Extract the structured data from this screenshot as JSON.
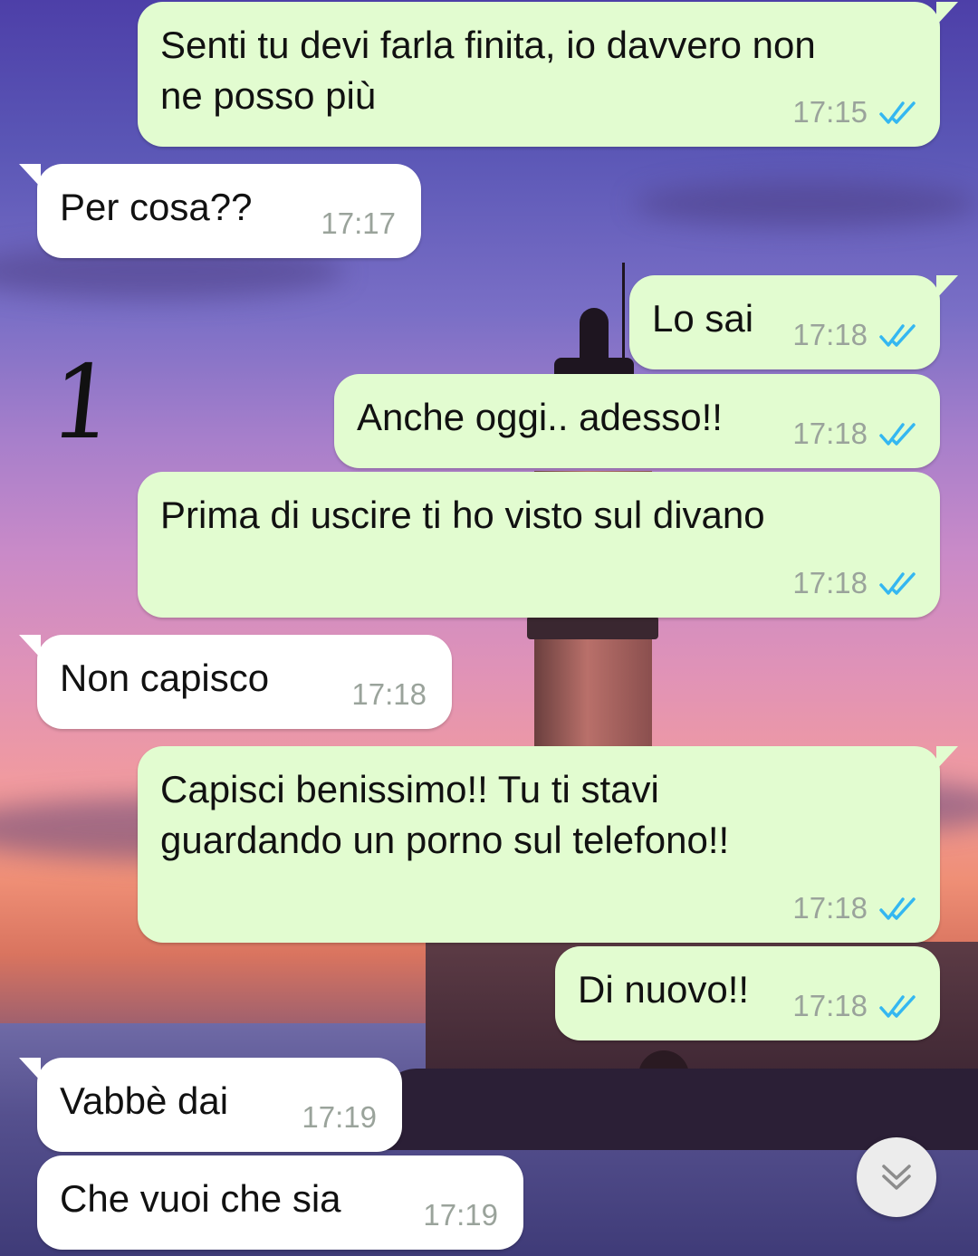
{
  "annotation": "1",
  "messages": [
    {
      "direction": "out",
      "text": "Senti tu devi farla finita, io davvero non\nne posso più",
      "time": "17:15",
      "status": "read"
    },
    {
      "direction": "in",
      "text": "Per cosa??",
      "time": "17:17"
    },
    {
      "direction": "out",
      "text": "Lo sai",
      "time": "17:18",
      "status": "read"
    },
    {
      "direction": "out",
      "text": "Anche oggi.. adesso!!",
      "time": "17:18",
      "status": "read"
    },
    {
      "direction": "out",
      "text": "Prima di uscire ti ho visto sul divano",
      "time": "17:18",
      "status": "read"
    },
    {
      "direction": "in",
      "text": "Non capisco",
      "time": "17:18"
    },
    {
      "direction": "out",
      "text": "Capisci benissimo!! Tu ti stavi\nguardando un porno sul telefono!!",
      "time": "17:18",
      "status": "read"
    },
    {
      "direction": "out",
      "text": "Di nuovo!!",
      "time": "17:18",
      "status": "read"
    },
    {
      "direction": "in",
      "text": "Vabbè dai",
      "time": "17:19"
    },
    {
      "direction": "in",
      "text": "Che vuoi che sia",
      "time": "17:19"
    }
  ],
  "colors": {
    "outgoing_bubble": "#e2fcd0",
    "incoming_bubble": "#ffffff",
    "read_ticks": "#34b7f1",
    "timestamp": "#9aa39b"
  },
  "scroll_button": {
    "icon": "double-chevron-down-icon"
  }
}
